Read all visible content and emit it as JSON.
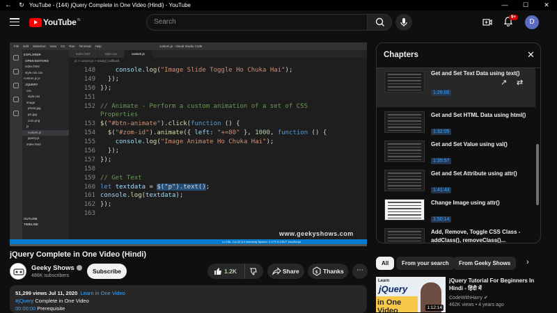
{
  "window": {
    "title": "YouTube - (144) jQuery Complete in One Video (Hindi) - YouTube"
  },
  "header": {
    "logo_text": "YouTube",
    "logo_country": "IN",
    "search_placeholder": "Search",
    "notification_count": "9+",
    "avatar_letter": "D"
  },
  "editor": {
    "app_title": "Visual Studio Code",
    "file_title": "custom.js",
    "menus": [
      "File",
      "Edit",
      "Selection",
      "View",
      "Go",
      "Run",
      "Terminal",
      "Help"
    ],
    "tabs": [
      "index.html",
      "style.css",
      "custom.js"
    ],
    "breadcrumb": "js > custom.js > ready() callback",
    "sidebar": [
      "EXPLORER",
      "OPEN EDITORS",
      "index.html",
      "style.css css",
      "custom.js js",
      "JQUERY",
      "css",
      "style.css",
      "image",
      "photo.jpg",
      "pic.jpg",
      "zom.png",
      "js",
      "custom.js",
      "jquery.js",
      "index.html"
    ],
    "sidebar_bottom": [
      "OUTLINE",
      "TIMELINE"
    ],
    "status_right": "Ln 160, Col 32 (14 selected)   Spaces: 4   UTF-8   CRLF   JavaScript",
    "watermark": "www.geekyshows.com"
  },
  "code_lines": [
    {
      "n": "148",
      "segs": [
        [
          "t",
          "    "
        ],
        [
          "var",
          "console"
        ],
        [
          "t",
          "."
        ],
        [
          "fn",
          "log"
        ],
        [
          "t",
          "("
        ],
        [
          "str",
          "\"Image Slide Toggle Ho Chuka Hai\""
        ],
        [
          "t",
          ");"
        ]
      ]
    },
    {
      "n": "149",
      "segs": [
        [
          "t",
          "  });"
        ]
      ]
    },
    {
      "n": "150",
      "segs": [
        [
          "t",
          "});"
        ]
      ]
    },
    {
      "n": "151",
      "segs": []
    },
    {
      "n": "152",
      "segs": [
        [
          "cm",
          "// Animate - Perform a custom animation of a set of CSS"
        ]
      ]
    },
    {
      "n": "",
      "segs": [
        [
          "cm",
          "Properties"
        ]
      ]
    },
    {
      "n": "153",
      "segs": [
        [
          "fn",
          "$"
        ],
        [
          "t",
          "("
        ],
        [
          "str",
          "\"#btn-animate\""
        ],
        [
          "t",
          ")."
        ],
        [
          "fn",
          "click"
        ],
        [
          "t",
          "("
        ],
        [
          "kw",
          "function"
        ],
        [
          "t",
          " () {"
        ]
      ]
    },
    {
      "n": "154",
      "segs": [
        [
          "t",
          "  "
        ],
        [
          "fn",
          "$"
        ],
        [
          "t",
          "("
        ],
        [
          "str",
          "\"#zom-id\""
        ],
        [
          "t",
          ")."
        ],
        [
          "fn",
          "animate"
        ],
        [
          "t",
          "({ "
        ],
        [
          "var",
          "left"
        ],
        [
          "t",
          ": "
        ],
        [
          "str",
          "\"+=80\""
        ],
        [
          "t",
          " }, "
        ],
        [
          "num",
          "1000"
        ],
        [
          "t",
          ", "
        ],
        [
          "kw",
          "function"
        ],
        [
          "t",
          " () {"
        ]
      ]
    },
    {
      "n": "155",
      "segs": [
        [
          "t",
          "    "
        ],
        [
          "var",
          "console"
        ],
        [
          "t",
          "."
        ],
        [
          "fn",
          "log"
        ],
        [
          "t",
          "("
        ],
        [
          "str",
          "\"Image Animate Ho Chuka Hai\""
        ],
        [
          "t",
          ");"
        ]
      ]
    },
    {
      "n": "156",
      "segs": [
        [
          "t",
          "  });"
        ]
      ]
    },
    {
      "n": "157",
      "segs": [
        [
          "t",
          "});"
        ]
      ]
    },
    {
      "n": "158",
      "segs": []
    },
    {
      "n": "159",
      "segs": [
        [
          "cm",
          "// Get Text"
        ]
      ]
    },
    {
      "n": "160",
      "segs": [
        [
          "kw",
          "let"
        ],
        [
          "t",
          " "
        ],
        [
          "var",
          "textdata"
        ],
        [
          "t",
          " = "
        ],
        [
          "hl",
          "$(\"p\").text()"
        ],
        [
          "t",
          ";"
        ]
      ]
    },
    {
      "n": "161",
      "segs": [
        [
          "var",
          "console"
        ],
        [
          "t",
          "."
        ],
        [
          "fn",
          "log"
        ],
        [
          "t",
          "("
        ],
        [
          "var",
          "textdata"
        ],
        [
          "t",
          ");"
        ]
      ]
    },
    {
      "n": "162",
      "segs": [
        [
          "t",
          "});"
        ]
      ]
    },
    {
      "n": "163",
      "segs": []
    }
  ],
  "video": {
    "title": "jQuery Complete in One Video (Hindi)",
    "channel": "Geeky Shows",
    "subscribers": "486K subscribers",
    "subscribe_label": "Subscribe",
    "likes": "1.2K",
    "share_label": "Share",
    "thanks_label": "Thanks",
    "progress_fraction": 0.0
  },
  "description": {
    "stats": "51,299 views  Jul 11, 2020",
    "playlist": "Learn in One Video",
    "hashtag": "#jQuery",
    "line2": "Complete in One Video",
    "ts": "00:00:00",
    "line3": "Prerequisite"
  },
  "chapters": {
    "heading": "Chapters",
    "items": [
      {
        "title": "Get and Set Text Data using text()",
        "time": "1:26:00",
        "active": true,
        "white": false
      },
      {
        "title": "Get and Set HTML Data using html()",
        "time": "1:32:05",
        "active": false,
        "white": false
      },
      {
        "title": "Get and Set Value using val()",
        "time": "1:35:57",
        "active": false,
        "white": false
      },
      {
        "title": "Get and Set Attribute using attr()",
        "time": "1:41:43",
        "active": false,
        "white": false
      },
      {
        "title": "Change Image using attr()",
        "time": "1:50:14",
        "active": false,
        "white": true
      },
      {
        "title": "Add, Remove, Toggle CSS Class - addClass(), removeClass()...",
        "time": "",
        "active": false,
        "white": false
      }
    ]
  },
  "chips": [
    "All",
    "From your search",
    "From Geeky Shows"
  ],
  "recommendation": {
    "thumb_top": "Learn",
    "thumb_brand": "jQuery",
    "thumb_banner": "in One Video",
    "duration": "1:12:14",
    "title": "jQuery Tutorial For Beginners In Hindi - हिंदी में",
    "channel": "CodeWithHarry",
    "meta": "462K views  •  4 years ago"
  }
}
